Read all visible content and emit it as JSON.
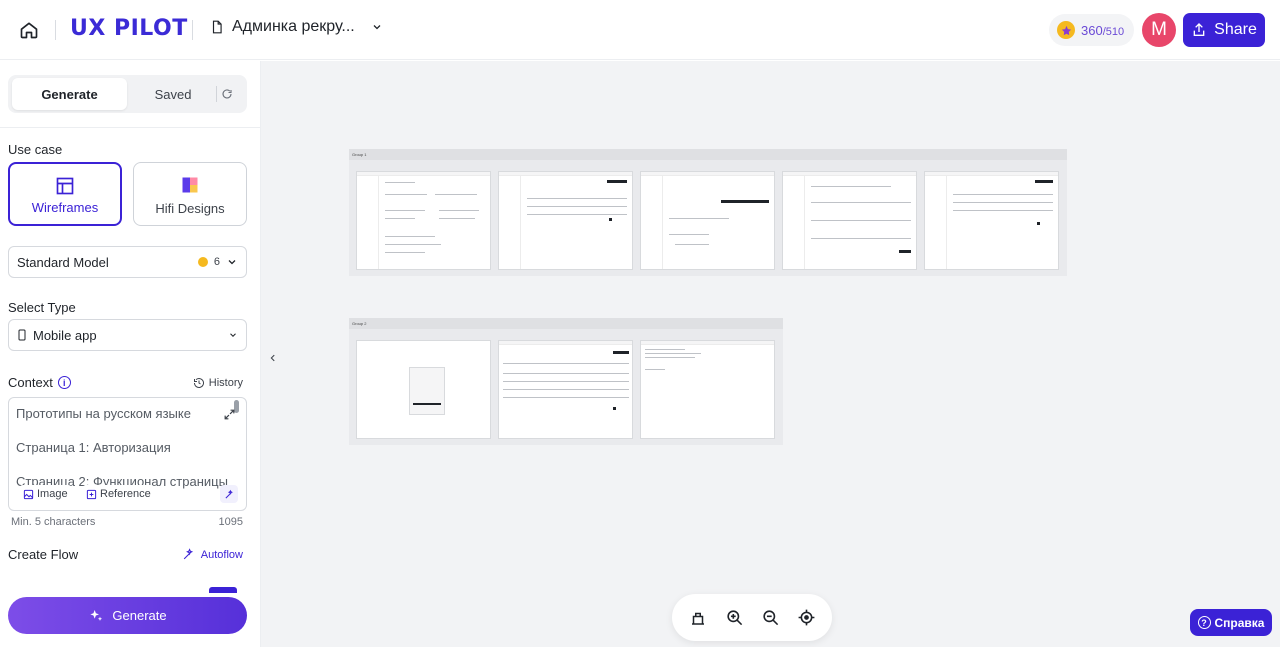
{
  "header": {
    "logo": "UX PILOT",
    "project_title": "Админка рекру...",
    "credits_used": "360",
    "credits_total": "/510",
    "avatar_letter": "M",
    "share_label": "Share"
  },
  "sidebar": {
    "tabs": {
      "generate": "Generate",
      "saved": "Saved"
    },
    "use_case_label": "Use case",
    "use_cases": [
      {
        "label": "Wireframes",
        "active": true
      },
      {
        "label": "Hifi Designs",
        "active": false
      }
    ],
    "model": {
      "value": "Standard Model",
      "cost": "6"
    },
    "select_type_label": "Select Type",
    "select_type_value": "Mobile app",
    "context_label": "Context",
    "history_label": "History",
    "context_lines": [
      "Прототипы на русском языке",
      "Страница 1: Авторизация",
      "Страница 2: Функционал страницы"
    ],
    "chips": {
      "image": "Image",
      "reference": "Reference"
    },
    "min_chars": "Min. 5 characters",
    "char_count": "1095",
    "create_flow_label": "Create Flow",
    "autoflow_label": "Autoflow",
    "generate_label": "Generate"
  },
  "canvas": {
    "groups": [
      {
        "name": "Group 1",
        "frames": 5
      },
      {
        "name": "Group 2",
        "frames": 3
      }
    ]
  },
  "help_label": "Справка",
  "colors": {
    "accent": "#3b22d6",
    "avatar": "#e8466a",
    "coin": "#f5b91f"
  }
}
